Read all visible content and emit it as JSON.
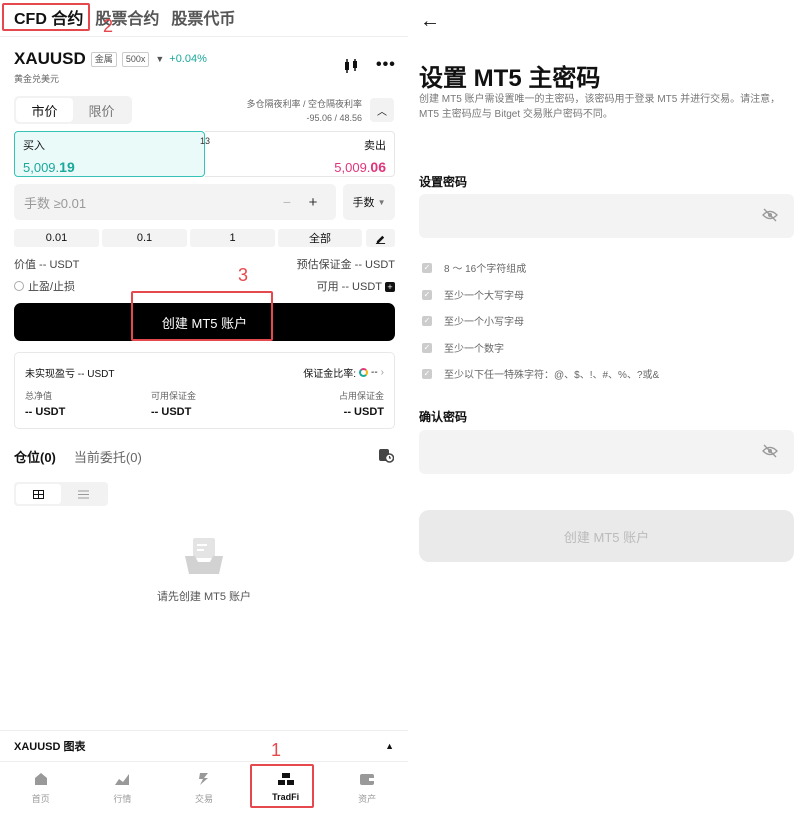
{
  "top_tabs": [
    "CFD 合约",
    "股票合约",
    "股票代币"
  ],
  "annotations": [
    "2",
    "3",
    "1"
  ],
  "symbol": {
    "name": "XAUUSD",
    "category_tag": "金属",
    "leverage": "500x",
    "change": "+0.04%",
    "subtitle": "黄金兑美元"
  },
  "order_types": [
    "市价",
    "限价"
  ],
  "funding": {
    "label": "多仓隔夜利率 / 空仓隔夜利率",
    "value": "-95.06 / 48.56"
  },
  "buy": {
    "label": "买入",
    "price_main": "5,009.",
    "price_tail": "19"
  },
  "sell": {
    "label": "卖出",
    "price_main": "5,009.",
    "price_tail": "06"
  },
  "spread": "13",
  "quantity": {
    "placeholder": "手数 ≥0.01",
    "minus": "−",
    "plus": "+",
    "unit": "手数"
  },
  "quick_amounts": [
    "0.01",
    "0.1",
    "1",
    "全部"
  ],
  "value_row": {
    "left": "价值 -- USDT",
    "right": "预估保证金 -- USDT"
  },
  "tpsl_row": {
    "left": "止盈/止损",
    "right": "可用 -- USDT"
  },
  "create_button": "创建 MT5 账户",
  "pnl_card": {
    "unrealized": "未实现盈亏 -- USDT",
    "margin_ratio_label": "保证金比率:",
    "margin_ratio_value": "--",
    "cols": [
      {
        "label": "总净值",
        "value": "-- USDT"
      },
      {
        "label": "可用保证金",
        "value": "-- USDT"
      },
      {
        "label": "占用保证金",
        "value": "-- USDT"
      }
    ]
  },
  "position_tabs": [
    "仓位(0)",
    "当前委托(0)"
  ],
  "empty_text": "请先创建 MT5 账户",
  "chart_bar": {
    "label": "XAUUSD 图表"
  },
  "bottom_nav": [
    "首页",
    "行情",
    "交易",
    "TradFi",
    "资产"
  ],
  "right": {
    "title": "设置 MT5 主密码",
    "description": "创建 MT5 账户需设置唯一的主密码，该密码用于登录 MT5 并进行交易。请注意，MT5 主密码应与 Bitget 交易账户密码不同。",
    "set_password_label": "设置密码",
    "rules": [
      "8 ～ 16个字符组成",
      "至少一个大写字母",
      "至少一个小写字母",
      "至少一个数字",
      "至少以下任一特殊字符：@、$、!、#、%、?或&"
    ],
    "confirm_password_label": "确认密码",
    "submit_button": "创建 MT5 账户"
  },
  "colors": {
    "buy_green": "#1aa89c",
    "sell_pink": "#e0357a",
    "annotation_red": "#e5484d"
  }
}
